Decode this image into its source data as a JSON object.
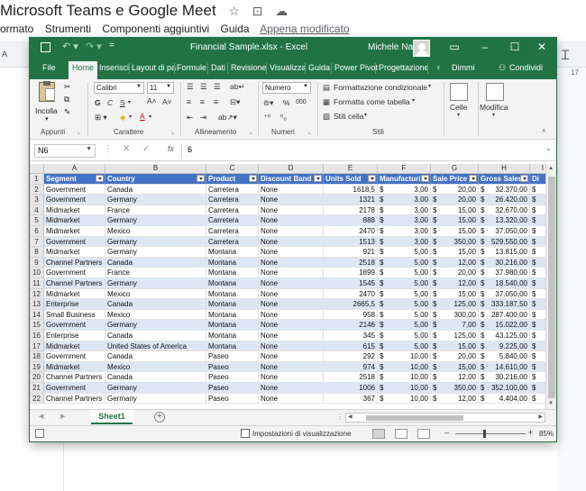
{
  "gdoc": {
    "title": "Microsoft Teams e Google Meet",
    "title_icons": [
      "star-icon",
      "folder-move-icon",
      "cloud-status-icon"
    ],
    "menu": [
      "ormato",
      "Strumenti",
      "Componenti aggiuntivi",
      "Guida",
      "Appena modificato"
    ],
    "ruler_number": "17",
    "left_fragment": "A"
  },
  "excel": {
    "quick_access": "=",
    "file_name": "Financial Sample.xlsx - Excel",
    "user_name": "Michele Nasi",
    "window_buttons": [
      "▭",
      "–",
      "☐",
      "✕"
    ],
    "tabs": [
      "File",
      "Home",
      "Inserisci",
      "Layout di pa",
      "Formule",
      "Dati",
      "Revisione",
      "Visualizza",
      "Guida",
      "Power Pivot",
      "Progettazione",
      "Dimmi",
      "Condividi"
    ],
    "ribbon": {
      "paste": "Incolla",
      "clipboard_group": "Appunti",
      "font_name": "Calibri",
      "font_size": "11",
      "font_group": "Carattere",
      "align_group": "Allineamento",
      "number_format": "Numero",
      "number_group": "Numeri",
      "cond_format": "Formattazione condizionale",
      "format_table": "Formatta come tabella",
      "cell_styles": "Stili cella",
      "styles_group": "Stili",
      "cells": "Celle",
      "edit": "Modifica",
      "font_buttons": [
        "G",
        "C",
        "S"
      ],
      "percent": "%",
      "thousands": "000"
    },
    "name_box": "N6",
    "formula_value": "6",
    "formula_fx": "fx",
    "col_letters": [
      "A",
      "B",
      "C",
      "D",
      "E",
      "F",
      "G",
      "H",
      "I"
    ],
    "headers": [
      "Segment",
      "Country",
      "Product",
      "Discount Band",
      "Units Sold",
      "Manufacturi",
      "Sale Price",
      "Gross Sales",
      "Di"
    ],
    "row_numbers": [
      "1",
      "2",
      "3",
      "4",
      "5",
      "6",
      "7",
      "8",
      "9",
      "10",
      "11",
      "12",
      "13",
      "14",
      "15",
      "16",
      "17",
      "18",
      "19",
      "20",
      "21",
      "22"
    ],
    "currency": "$",
    "rows": [
      [
        "Government",
        "Canada",
        "Carretera",
        "None",
        "1618,5",
        "3,00",
        "20,00",
        "32.370,00"
      ],
      [
        "Government",
        "Germany",
        "Carretera",
        "None",
        "1321",
        "3,00",
        "20,00",
        "26.420,00"
      ],
      [
        "Midmarket",
        "France",
        "Carretera",
        "None",
        "2178",
        "3,00",
        "15,00",
        "32.670,00"
      ],
      [
        "Midmarket",
        "Germany",
        "Carretera",
        "None",
        "888",
        "3,00",
        "15,00",
        "13.320,00"
      ],
      [
        "Midmarket",
        "Mexico",
        "Carretera",
        "None",
        "2470",
        "3,00",
        "15,00",
        "37.050,00"
      ],
      [
        "Government",
        "Germany",
        "Carretera",
        "None",
        "1513",
        "3,00",
        "350,00",
        "529.550,00"
      ],
      [
        "Midmarket",
        "Germany",
        "Montana",
        "None",
        "921",
        "5,00",
        "15,00",
        "13.815,00"
      ],
      [
        "Channel Partners",
        "Canada",
        "Montana",
        "None",
        "2518",
        "5,00",
        "12,00",
        "30.216,00"
      ],
      [
        "Government",
        "France",
        "Montana",
        "None",
        "1899",
        "5,00",
        "20,00",
        "37.980,00"
      ],
      [
        "Channel Partners",
        "Germany",
        "Montana",
        "None",
        "1545",
        "5,00",
        "12,00",
        "18.540,00"
      ],
      [
        "Midmarket",
        "Mexico",
        "Montana",
        "None",
        "2470",
        "5,00",
        "15,00",
        "37.050,00"
      ],
      [
        "Enterprise",
        "Canada",
        "Montana",
        "None",
        "2665,5",
        "5,00",
        "125,00",
        "333.187,50"
      ],
      [
        "Small Business",
        "Mexico",
        "Montana",
        "None",
        "958",
        "5,00",
        "300,00",
        "287.400,00"
      ],
      [
        "Government",
        "Germany",
        "Montana",
        "None",
        "2146",
        "5,00",
        "7,00",
        "15.022,00"
      ],
      [
        "Enterprise",
        "Canada",
        "Montana",
        "None",
        "345",
        "5,00",
        "125,00",
        "43.125,00"
      ],
      [
        "Midmarket",
        "United States of America",
        "Montana",
        "None",
        "615",
        "5,00",
        "15,00",
        "9.225,00"
      ],
      [
        "Government",
        "Canada",
        "Paseo",
        "None",
        "292",
        "10,00",
        "20,00",
        "5.840,00"
      ],
      [
        "Midmarket",
        "Mexico",
        "Paseo",
        "None",
        "974",
        "10,00",
        "15,00",
        "14.610,00"
      ],
      [
        "Channel Partners",
        "Canada",
        "Paseo",
        "None",
        "2518",
        "10,00",
        "12,00",
        "30.216,00"
      ],
      [
        "Government",
        "Germany",
        "Paseo",
        "None",
        "1006",
        "10,00",
        "350,00",
        "352.100,00"
      ],
      [
        "Channel Partners",
        "Germany",
        "Paseo",
        "None",
        "367",
        "10,00",
        "12,00",
        "4.404,00"
      ]
    ],
    "sheet_tab": "Sheet1",
    "add_sheet": "+",
    "status_display": "Impostazioni di visualizzazione",
    "zoom_minus": "–",
    "zoom_plus": "+",
    "zoom": "85%",
    "zoom_fraction": 0.4
  }
}
